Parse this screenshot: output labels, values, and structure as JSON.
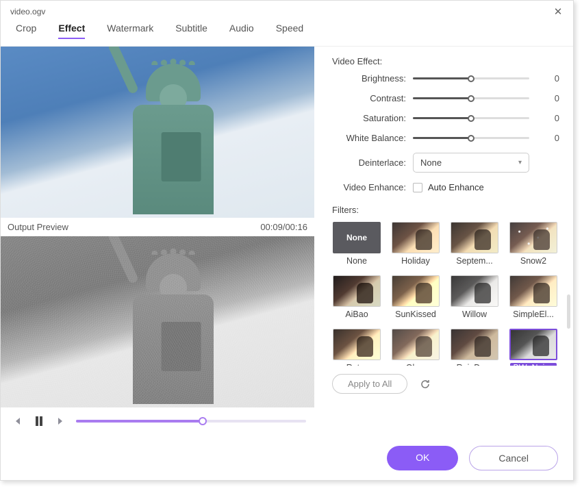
{
  "window": {
    "title": "video.ogv"
  },
  "tabs": [
    "Crop",
    "Effect",
    "Watermark",
    "Subtitle",
    "Audio",
    "Speed"
  ],
  "active_tab": "Effect",
  "preview": {
    "label": "Output Preview",
    "time": "00:09/00:16",
    "progress_pct": 55
  },
  "effects": {
    "section": "Video Effect:",
    "sliders": [
      {
        "label": "Brightness:",
        "value": 0,
        "pct": 50
      },
      {
        "label": "Contrast:",
        "value": 0,
        "pct": 50
      },
      {
        "label": "Saturation:",
        "value": 0,
        "pct": 50
      },
      {
        "label": "White Balance:",
        "value": 0,
        "pct": 50
      }
    ],
    "deinterlace_label": "Deinterlace:",
    "deinterlace_value": "None",
    "enhance_label": "Video Enhance:",
    "enhance_option": "Auto Enhance"
  },
  "filters_label": "Filters:",
  "filters": [
    {
      "name": "None",
      "class": "none"
    },
    {
      "name": "Holiday",
      "class": "f-holiday"
    },
    {
      "name": "Septem...",
      "class": "f-sept"
    },
    {
      "name": "Snow2",
      "class": "f-snow"
    },
    {
      "name": "AiBao",
      "class": "f-aibao"
    },
    {
      "name": "SunKissed",
      "class": "f-sun"
    },
    {
      "name": "Willow",
      "class": "f-willow"
    },
    {
      "name": "SimpleEl...",
      "class": "f-simple"
    },
    {
      "name": "Retro",
      "class": "f-retro"
    },
    {
      "name": "Glow",
      "class": "f-glow"
    },
    {
      "name": "RainDrop",
      "class": "f-rain"
    },
    {
      "name": "BW_Noise",
      "class": "f-bwn",
      "selected": true
    }
  ],
  "apply_all": "Apply to All",
  "buttons": {
    "ok": "OK",
    "cancel": "Cancel"
  }
}
